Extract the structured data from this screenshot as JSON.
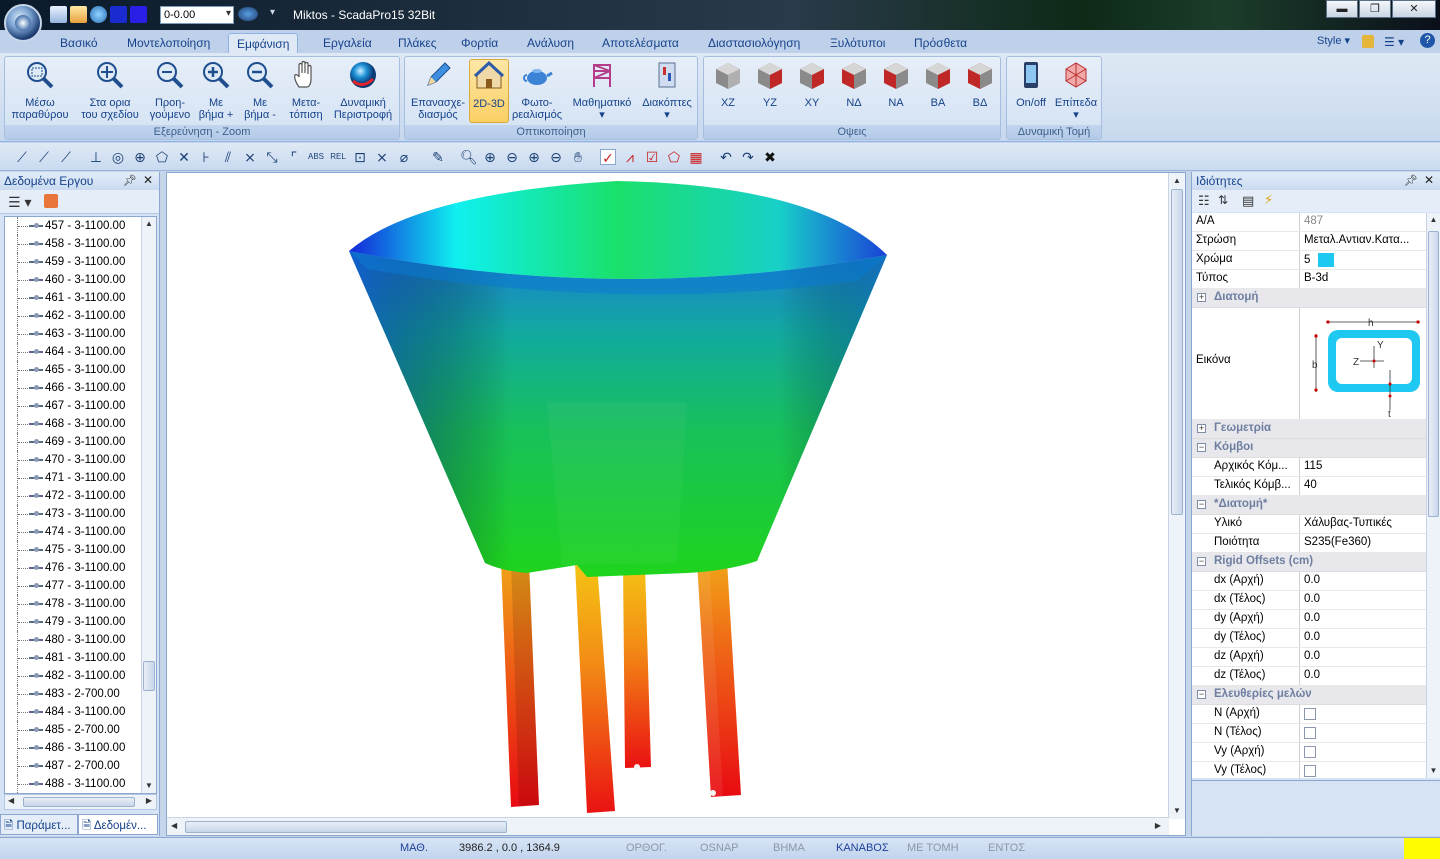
{
  "titlebar": {
    "title": "Miktos - ScadaPro15 32Bit",
    "layer_combo": "0-0.00",
    "win_minimize": "▬",
    "win_restore": "❐",
    "win_close": "✕"
  },
  "tabs": [
    "Βασικό",
    "Μοντελοποίηση",
    "Εμφάνιση",
    "Εργαλεία",
    "Πλάκες",
    "Φορτία",
    "Ανάλυση",
    "Αποτελέσματα",
    "Διαστασιολόγηση",
    "Ξυλότυποι",
    "Πρόσθετα"
  ],
  "active_tab": "Εμφάνιση",
  "style_label": "Style",
  "ribbon": {
    "zoom_group": {
      "label": "Εξερεύνηση - Zoom",
      "buttons": [
        {
          "line1": "Μέσω",
          "line2": "παραθύρου"
        },
        {
          "line1": "Στα ορια",
          "line2": "του σχεδίου"
        },
        {
          "line1": "Προη-",
          "line2": "γούμενο"
        },
        {
          "line1": "Με",
          "line2": "βήμα +"
        },
        {
          "line1": "Με",
          "line2": "βήμα -"
        },
        {
          "line1": "Μετα-",
          "line2": "τόπιση"
        },
        {
          "line1": "Δυναμική",
          "line2": "Περιστροφή"
        }
      ]
    },
    "vis_group": {
      "label": "Οπτικοποίηση",
      "buttons": [
        {
          "line1": "Επανασχε-",
          "line2": "διασμός"
        },
        {
          "line1": "2D-3D",
          "line2": ""
        },
        {
          "line1": "Φωτο-",
          "line2": "ρεαλισμός"
        },
        {
          "line1": "Μαθηματικό",
          "line2": "▾"
        },
        {
          "line1": "Διακόπτες",
          "line2": "▾"
        }
      ]
    },
    "views_group": {
      "label": "Οψεις",
      "buttons": [
        "XZ",
        "YZ",
        "XY",
        "ΝΔ",
        "ΝΑ",
        "ΒΑ",
        "ΒΔ"
      ]
    },
    "section_group": {
      "label": "Δυναμική Τομή",
      "buttons": [
        {
          "line1": "On/off",
          "line2": ""
        },
        {
          "line1": "Επίπεδα",
          "line2": "▾"
        }
      ]
    }
  },
  "left_panel": {
    "title": "Δεδομένα Εργου",
    "items": [
      "457 - 3-1100.00",
      "458 - 3-1100.00",
      "459 - 3-1100.00",
      "460 - 3-1100.00",
      "461 - 3-1100.00",
      "462 - 3-1100.00",
      "463 - 3-1100.00",
      "464 - 3-1100.00",
      "465 - 3-1100.00",
      "466 - 3-1100.00",
      "467 - 3-1100.00",
      "468 - 3-1100.00",
      "469 - 3-1100.00",
      "470 - 3-1100.00",
      "471 - 3-1100.00",
      "472 - 3-1100.00",
      "473 - 3-1100.00",
      "474 - 3-1100.00",
      "475 - 3-1100.00",
      "476 - 3-1100.00",
      "477 - 3-1100.00",
      "478 - 3-1100.00",
      "479 - 3-1100.00",
      "480 - 3-1100.00",
      "481 - 3-1100.00",
      "482 - 3-1100.00",
      "483 - 2-700.00",
      "484 - 3-1100.00",
      "485 - 2-700.00",
      "486 - 3-1100.00",
      "487 - 2-700.00",
      "488 - 3-1100.00"
    ],
    "tab1": "Παράμετ...",
    "tab2": "Δεδομέν..."
  },
  "right_panel": {
    "title": "Ιδιότητες",
    "rows": {
      "aa_k": "Α/Α",
      "aa_v": "487",
      "layer_k": "Στρώση",
      "layer_v": "Μεταλ.Αντιαν.Κατα...",
      "color_k": "Χρώμα",
      "color_v": "5",
      "type_k": "Τύπος",
      "type_v": "B-3d",
      "cat_section": "Διατομή",
      "image_k": "Εικόνα",
      "cat_geometry": "Γεωμετρία",
      "cat_nodes": "Κόμβοι",
      "start_node_k": "Αρχικός Κόμ...",
      "start_node_v": "115",
      "end_node_k": "Τελικός Κόμβ...",
      "end_node_v": "40",
      "cat_section2": "*Διατομή*",
      "material_k": "Υλικό",
      "material_v": "Χάλυβας-Τυπικές",
      "quality_k": "Ποιότητα",
      "quality_v": "S235(Fe360)",
      "cat_rigid": "Rigid Offsets (cm)",
      "dx1_k": "dx (Αρχή)",
      "dx1_v": "0.0",
      "dx2_k": "dx (Τέλος)",
      "dx2_v": "0.0",
      "dy1_k": "dy (Αρχή)",
      "dy1_v": "0.0",
      "dy2_k": "dy (Τέλος)",
      "dy2_v": "0.0",
      "dz1_k": "dz (Αρχή)",
      "dz1_v": "0.0",
      "dz2_k": "dz (Τέλος)",
      "dz2_v": "0.0",
      "cat_releases": "Ελευθερίες μελών",
      "n1_k": "N (Αρχή)",
      "n2_k": "N (Τέλος)",
      "vy1_k": "Vy (Αρχή)",
      "vy2_k": "Vy (Τέλος)"
    },
    "section_labels": {
      "h": "h",
      "b": "b",
      "y": "Y",
      "z": "Z",
      "t": "t"
    },
    "swatch_color": "#1ec8f0"
  },
  "statusbar": {
    "math": "ΜΑΘ.",
    "coords": "3986.2 , 0.0 , 1364.9",
    "orthog": "ΟΡΘΟΓ.",
    "osnap": "OSNAP",
    "step": "ΒΗΜΑ",
    "grid": "ΚΑΝΑΒΟΣ",
    "cut": "ΜΕ ΤΟΜΗ",
    "inside": "ΕΝΤΟΣ"
  }
}
